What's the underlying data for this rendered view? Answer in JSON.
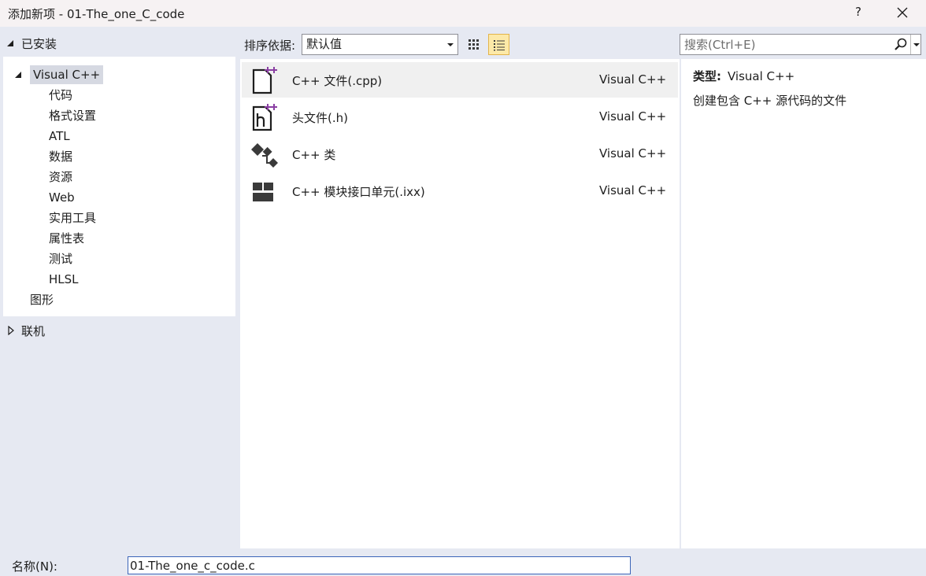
{
  "window": {
    "title": "添加新项 - 01-The_one_C_code",
    "help_label": "?"
  },
  "left": {
    "installed_label": "已安装",
    "root_label": "Visual C++",
    "children": [
      "代码",
      "格式设置",
      "ATL",
      "数据",
      "资源",
      "Web",
      "实用工具",
      "属性表",
      "测试",
      "HLSL"
    ],
    "graphics_label": "图形",
    "online_label": "联机"
  },
  "toolbar": {
    "sort_label": "排序依据:",
    "sort_value": "默认值",
    "search_placeholder": "搜索(Ctrl+E)"
  },
  "items": [
    {
      "name": "C++ 文件(.cpp)",
      "category": "Visual C++",
      "icon": "cpp-file-icon",
      "selected": true
    },
    {
      "name": "头文件(.h)",
      "category": "Visual C++",
      "icon": "header-file-icon",
      "selected": false
    },
    {
      "name": "C++ 类",
      "category": "Visual C++",
      "icon": "class-icon",
      "selected": false
    },
    {
      "name": "C++ 模块接口单元(.ixx)",
      "category": "Visual C++",
      "icon": "module-icon",
      "selected": false
    }
  ],
  "detail": {
    "type_label": "类型:",
    "type_value": "Visual C++",
    "description": "创建包含 C++ 源代码的文件"
  },
  "bottom": {
    "name_label": "名称(N):",
    "name_value": "01-The_one_c_code.c"
  },
  "colors": {
    "accent": "#8a3fa3",
    "selection": "#d6d9e2",
    "list_view_active": "#fde9a8"
  }
}
